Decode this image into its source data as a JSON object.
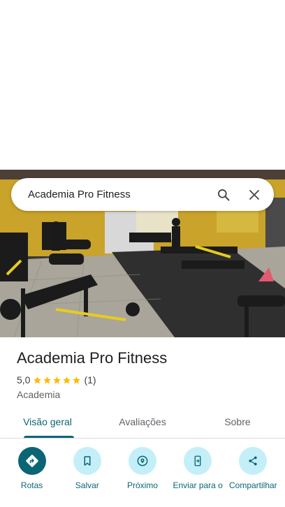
{
  "search": {
    "query": "Academia Pro Fitness"
  },
  "place": {
    "name": "Academia Pro Fitness",
    "rating": "5,0",
    "review_count": "(1)",
    "category": "Academia",
    "stars": 5
  },
  "tabs": [
    {
      "label": "Visão geral",
      "active": true
    },
    {
      "label": "Avaliações",
      "active": false
    },
    {
      "label": "Sobre",
      "active": false
    }
  ],
  "actions": [
    {
      "label": "Rotas",
      "icon": "directions-icon"
    },
    {
      "label": "Salvar",
      "icon": "bookmark-icon"
    },
    {
      "label": "Próximo",
      "icon": "nearby-icon"
    },
    {
      "label": "Enviar para o",
      "icon": "send-to-phone-icon"
    },
    {
      "label": "Compartilhar",
      "icon": "share-icon"
    }
  ],
  "colors": {
    "accent": "#0b6575",
    "chip": "#c4eff8",
    "star": "#fbbc04"
  }
}
